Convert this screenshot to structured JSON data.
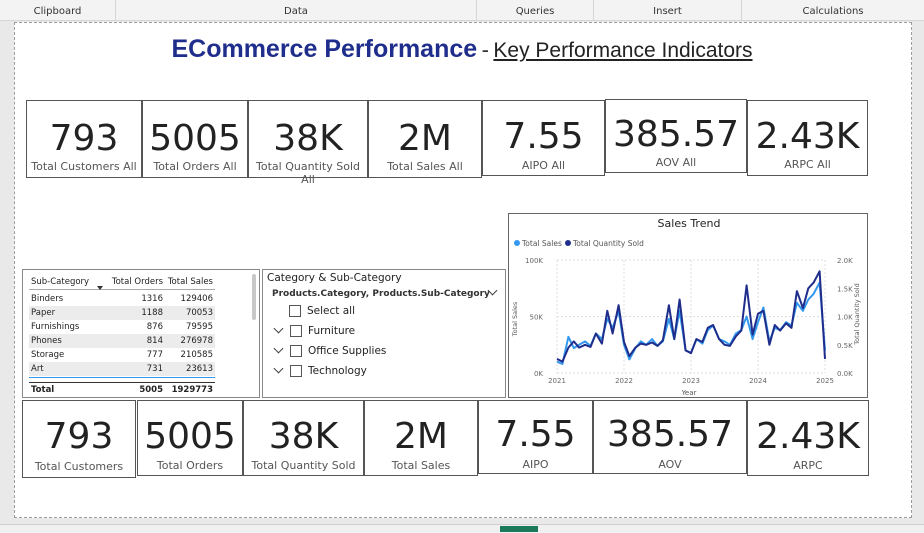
{
  "ribbon": [
    {
      "label": "Clipboard"
    },
    {
      "label": "Data"
    },
    {
      "label": "Queries"
    },
    {
      "label": "Insert"
    },
    {
      "label": "Calculations"
    }
  ],
  "title": {
    "main": "ECommerce Performance",
    "dash": "-",
    "sub": "Key Performance Indicators"
  },
  "top_cards": [
    {
      "value": "793",
      "label": "Total Customers All"
    },
    {
      "value": "5005",
      "label": "Total Orders All"
    },
    {
      "value": "38K",
      "label": "Total Quantity Sold All"
    },
    {
      "value": "2M",
      "label": "Total Sales All"
    },
    {
      "value": "7.55",
      "label": "AIPO All"
    },
    {
      "value": "385.57",
      "label": "AOV All"
    },
    {
      "value": "2.43K",
      "label": "ARPC All"
    }
  ],
  "bottom_cards": [
    {
      "value": "793",
      "label": "Total Customers"
    },
    {
      "value": "5005",
      "label": "Total Orders"
    },
    {
      "value": "38K",
      "label": "Total Quantity Sold"
    },
    {
      "value": "2M",
      "label": "Total Sales"
    },
    {
      "value": "7.55",
      "label": "AIPO"
    },
    {
      "value": "385.57",
      "label": "AOV"
    },
    {
      "value": "2.43K",
      "label": "ARPC"
    }
  ],
  "table": {
    "headers": [
      "Sub-Category",
      "Total Orders",
      "Total Sales"
    ],
    "rows": [
      [
        "Binders",
        "1316",
        "129406"
      ],
      [
        "Paper",
        "1188",
        "70053"
      ],
      [
        "Furnishings",
        "876",
        "79595"
      ],
      [
        "Phones",
        "814",
        "276978"
      ],
      [
        "Storage",
        "777",
        "210585"
      ],
      [
        "Art",
        "731",
        "23613"
      ]
    ],
    "total": [
      "Total",
      "5005",
      "1929773"
    ]
  },
  "slicer": {
    "title": "Category & Sub-Category",
    "field": "Products.Category, Products.Sub-Category",
    "select_all": "Select all",
    "items": [
      "Furniture",
      "Office Supplies",
      "Technology"
    ]
  },
  "chart_data": {
    "type": "line",
    "title": "Sales Trend",
    "xlabel": "Year",
    "ylabel": "Total Sales",
    "y2label": "Total Quantity Sold",
    "x_ticks": [
      "2021",
      "2022",
      "2023",
      "2024",
      "2025"
    ],
    "y_ticks": [
      "0K",
      "50K",
      "100K"
    ],
    "y2_ticks": [
      "0.0K",
      "0.5K",
      "1.0K",
      "1.5K",
      "2.0K"
    ],
    "ylim": [
      0,
      100000
    ],
    "y2lim": [
      0,
      2000
    ],
    "legend_position": "top-left",
    "colors": {
      "sales": "#3399ee",
      "quantity": "#1f2d8c"
    },
    "x": [
      2021.0,
      2021.08,
      2021.17,
      2021.25,
      2021.33,
      2021.42,
      2021.5,
      2021.58,
      2021.67,
      2021.75,
      2021.83,
      2021.92,
      2022.0,
      2022.08,
      2022.17,
      2022.25,
      2022.33,
      2022.42,
      2022.5,
      2022.58,
      2022.67,
      2022.75,
      2022.83,
      2022.92,
      2023.0,
      2023.08,
      2023.17,
      2023.25,
      2023.33,
      2023.42,
      2023.5,
      2023.58,
      2023.67,
      2023.75,
      2023.83,
      2023.92,
      2024.0,
      2024.08,
      2024.17,
      2024.25,
      2024.33,
      2024.42,
      2024.5,
      2024.58,
      2024.67,
      2024.75,
      2024.83,
      2024.92,
      2025.0
    ],
    "series": [
      {
        "name": "Total Sales",
        "values": [
          10000,
          8000,
          32000,
          22000,
          25000,
          28000,
          24000,
          35000,
          30000,
          48000,
          40000,
          55000,
          25000,
          12000,
          22000,
          28000,
          25000,
          30000,
          24000,
          28000,
          48000,
          30000,
          55000,
          20000,
          18000,
          30000,
          26000,
          38000,
          42000,
          30000,
          28000,
          25000,
          35000,
          38000,
          50000,
          30000,
          45000,
          58000,
          28000,
          40000,
          38000,
          45000,
          42000,
          62000,
          55000,
          65000,
          70000,
          80000,
          20000
        ]
      },
      {
        "name": "Total Quantity Sold",
        "values": [
          250,
          200,
          450,
          560,
          450,
          500,
          460,
          700,
          520,
          1100,
          700,
          1200,
          550,
          300,
          450,
          520,
          500,
          540,
          480,
          580,
          1200,
          600,
          1300,
          400,
          350,
          600,
          550,
          800,
          850,
          600,
          500,
          480,
          650,
          750,
          1550,
          680,
          1050,
          1100,
          500,
          850,
          750,
          880,
          800,
          1450,
          1150,
          1500,
          1600,
          1800,
          250
        ]
      }
    ],
    "legend": [
      "Total Sales",
      "Total Quantity Sold"
    ]
  }
}
